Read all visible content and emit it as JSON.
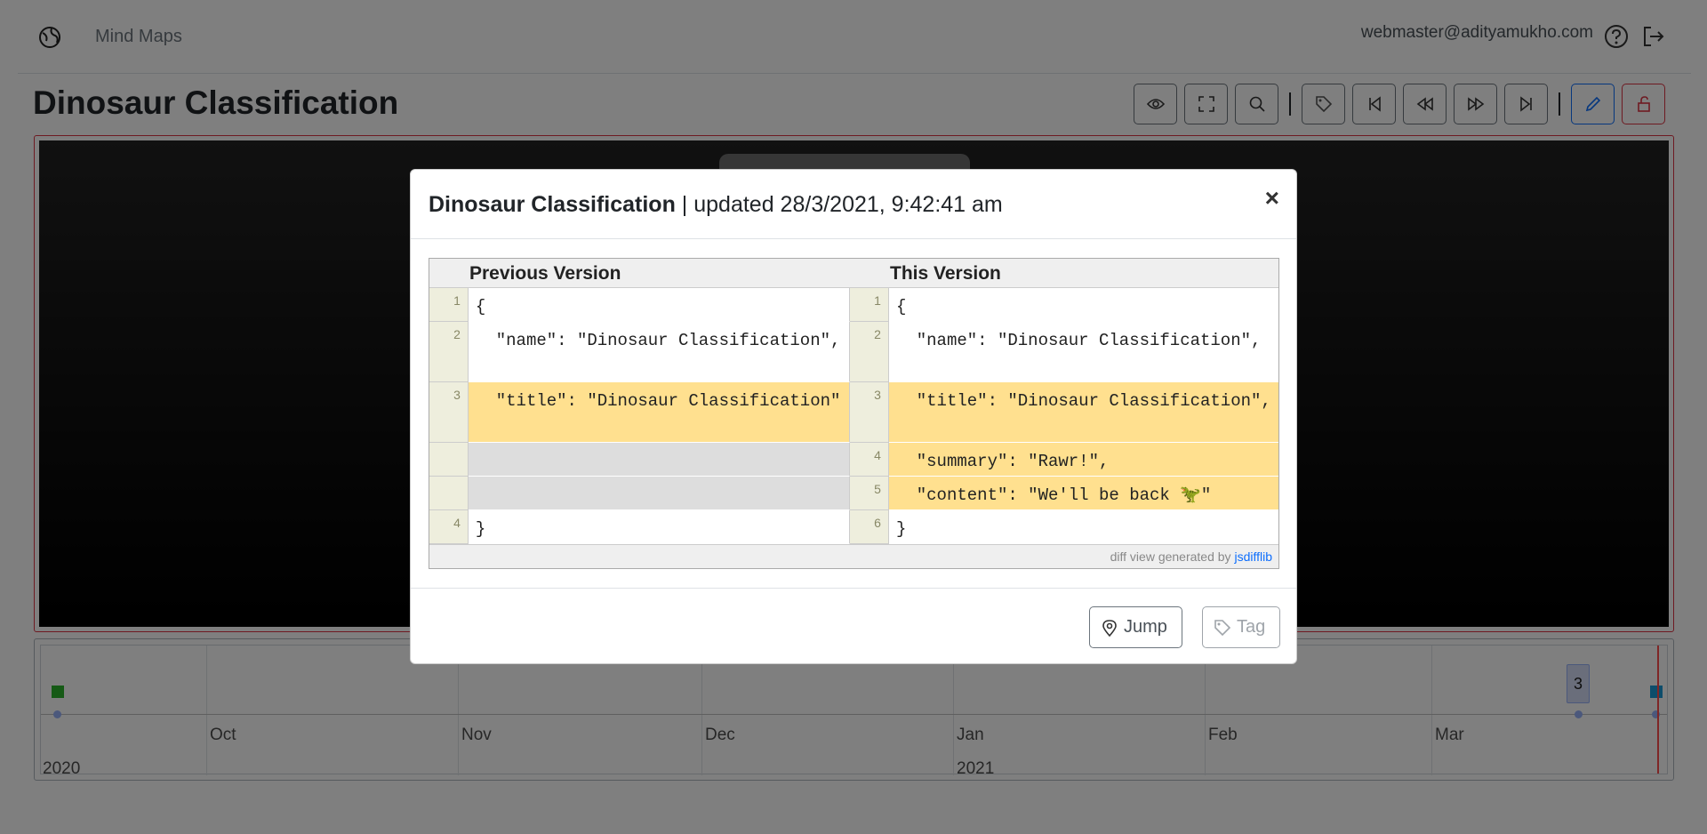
{
  "nav": {
    "brand": "Mind Maps",
    "user_email": "webmaster@adityamukho.com"
  },
  "page": {
    "title": "Dinosaur Classification"
  },
  "timeline": {
    "months": [
      "Oct",
      "Nov",
      "Dec",
      "Jan",
      "Feb",
      "Mar"
    ],
    "years": [
      "2020",
      "2021"
    ],
    "cluster_count": "3"
  },
  "modal": {
    "title_name": "Dinosaur Classification",
    "title_suffix": " | updated 28/3/2021, 9:42:41 am",
    "close_symbol": "×",
    "diff": {
      "left_header": "Previous Version",
      "right_header": "This Version",
      "rows": [
        {
          "left_num": "1",
          "left": "{",
          "right_num": "1",
          "right": "{"
        },
        {
          "left_num": "2",
          "left": "  \"name\": \"Dinosaur Classification\",",
          "right_num": "2",
          "right": "  \"name\": \"Dinosaur Classification\","
        },
        {
          "left_num": "3",
          "left": "  \"title\": \"Dinosaur Classification\"",
          "right_num": "3",
          "right": "  \"title\": \"Dinosaur Classification\","
        },
        {
          "left_num": "",
          "left": "",
          "right_num": "4",
          "right": "  \"summary\": \"Rawr!\","
        },
        {
          "left_num": "",
          "left": "",
          "right_num": "5",
          "right": "  \"content\": \"We'll be back 🦖\""
        },
        {
          "left_num": "4",
          "left": "}",
          "right_num": "6",
          "right": "}"
        }
      ],
      "footer_text": "diff view generated by ",
      "footer_link": "jsdifflib"
    },
    "jump_label": "Jump",
    "tag_label": "Tag"
  },
  "colors": {
    "changed": "#ffe08f",
    "empty": "#dddddd",
    "danger": "#dc3545",
    "primary": "#0d6efd"
  }
}
